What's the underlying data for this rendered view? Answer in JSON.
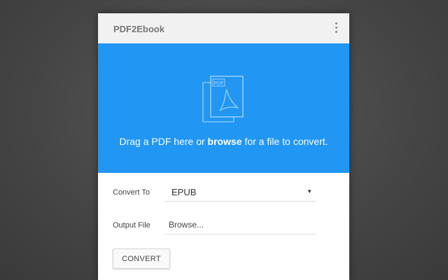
{
  "app": {
    "title": "PDF2Ebook",
    "menu_icon": "more-vertical-icon"
  },
  "dropzone": {
    "icon": "pdf-file-icon",
    "icon_label": "PDF",
    "text_before": "Drag a PDF here or ",
    "link_text": "browse",
    "text_after": " for a file to convert.",
    "color": "#2196f3"
  },
  "form": {
    "convert_to": {
      "label": "Convert To",
      "value": "EPUB"
    },
    "output_file": {
      "label": "Output File",
      "placeholder": "Browse..."
    },
    "convert_button": "CONVERT"
  }
}
